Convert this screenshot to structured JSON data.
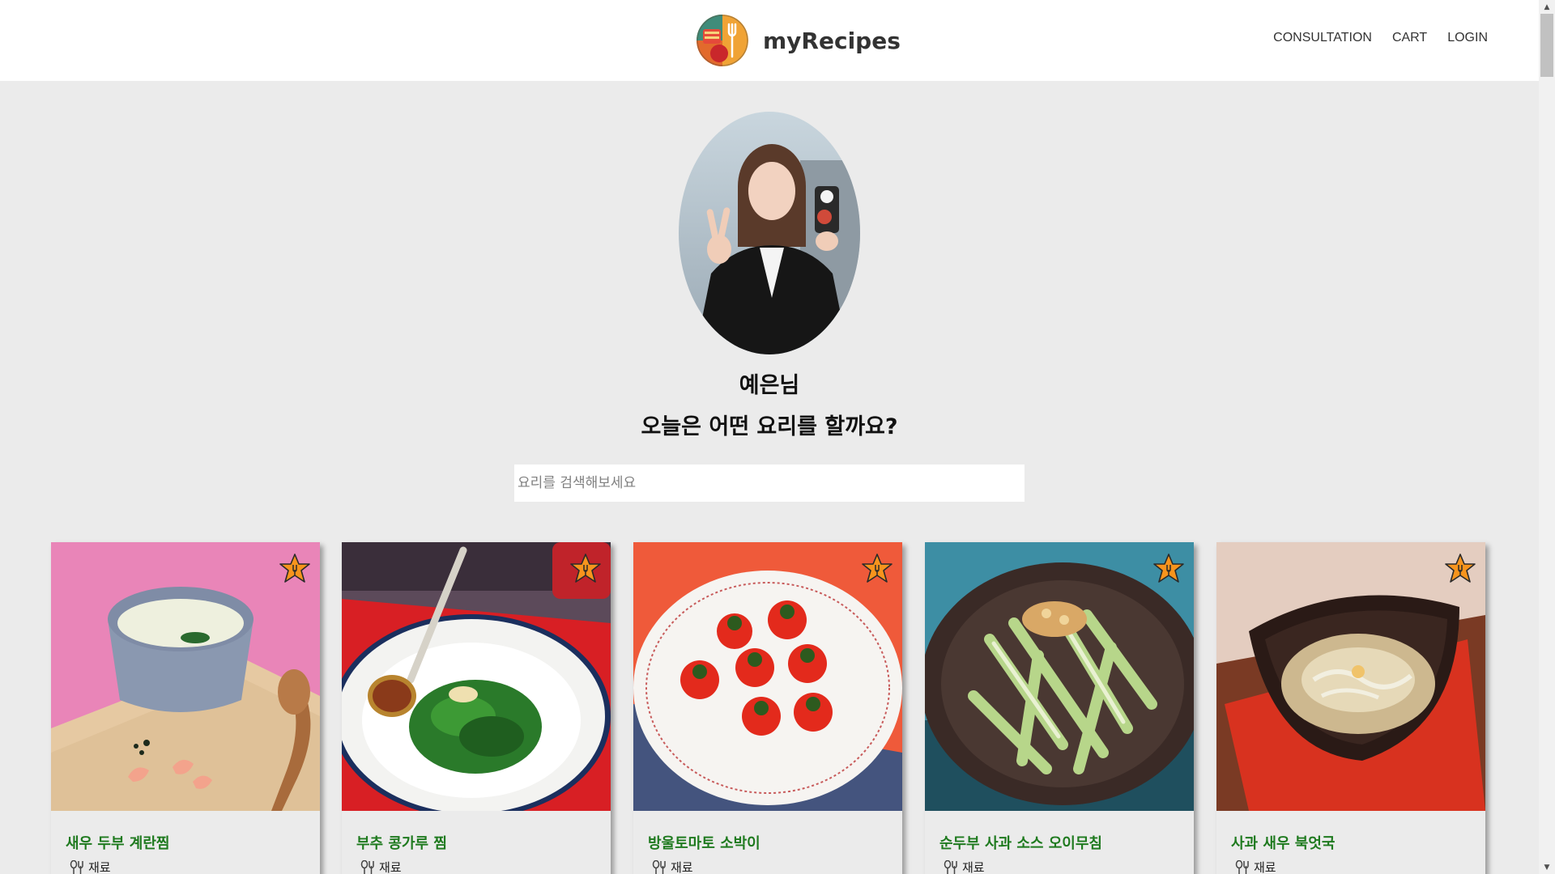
{
  "header": {
    "brand": "myRecipes",
    "nav": [
      "CONSULTATION",
      "CART",
      "LOGIN"
    ]
  },
  "profile": {
    "name": "예은님",
    "question": "오늘은 어떤 요리를 할까요?"
  },
  "search": {
    "placeholder": "요리를 검색해보세요",
    "value": ""
  },
  "recipes": [
    {
      "title": "새우 두부 계란찜",
      "meta": "재료"
    },
    {
      "title": "부추 콩가루 찜",
      "meta": "재료"
    },
    {
      "title": "방울토마토 소박이",
      "meta": "재료"
    },
    {
      "title": "순두부 사과 소스 오이무침",
      "meta": "재료"
    },
    {
      "title": "사과 새우 북엇국",
      "meta": "재료"
    }
  ],
  "colors": {
    "background": "#ebebeb",
    "title_green": "#1f7a1f",
    "star_orange": "#f7941d"
  },
  "icons": {
    "favorite": "star-badge-icon",
    "ingredients": "spoon-fork-icon"
  }
}
